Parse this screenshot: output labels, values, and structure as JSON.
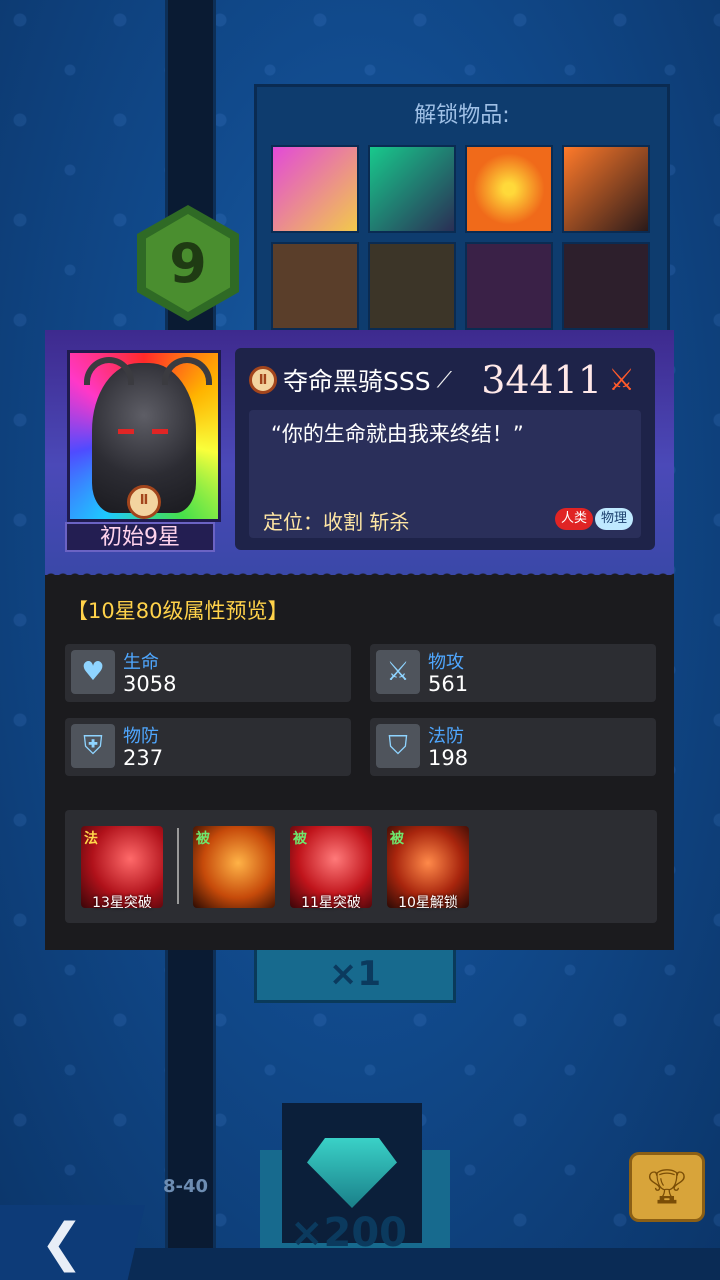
{
  "background": {
    "unlock_title": "解锁物品:",
    "level": "9",
    "reward_x1": "×1",
    "reward_x200": "×200",
    "level_range": "8-40"
  },
  "hero": {
    "name": "夺命黑骑SSS",
    "power": "34411",
    "star_label": "初始9星",
    "quote": "“你的生命就由我来终结！”",
    "role": "定位：收割 斩杀",
    "tags": [
      "人类",
      "物理"
    ]
  },
  "preview": {
    "title": "【10星80级属性预览】",
    "stats": [
      {
        "label": "生命",
        "value": "3058",
        "icon": "heart-icon"
      },
      {
        "label": "物攻",
        "value": "561",
        "icon": "sword-icon"
      },
      {
        "label": "物防",
        "value": "237",
        "icon": "shield-sword-icon"
      },
      {
        "label": "法防",
        "value": "198",
        "icon": "shield-magic-icon"
      }
    ]
  },
  "skills": [
    {
      "type": "法",
      "caption": "13星突破",
      "type_color": "#ffd84a"
    },
    {
      "type": "被",
      "caption": "",
      "type_color": "#6ee86e"
    },
    {
      "type": "被",
      "caption": "11星突破",
      "type_color": "#6ee86e"
    },
    {
      "type": "被",
      "caption": "10星解锁",
      "type_color": "#6ee86e"
    }
  ],
  "colors": {
    "stat_label": "#4fa7ff",
    "preview_title": "#ffd24a",
    "role_text": "#ffe6a4"
  }
}
